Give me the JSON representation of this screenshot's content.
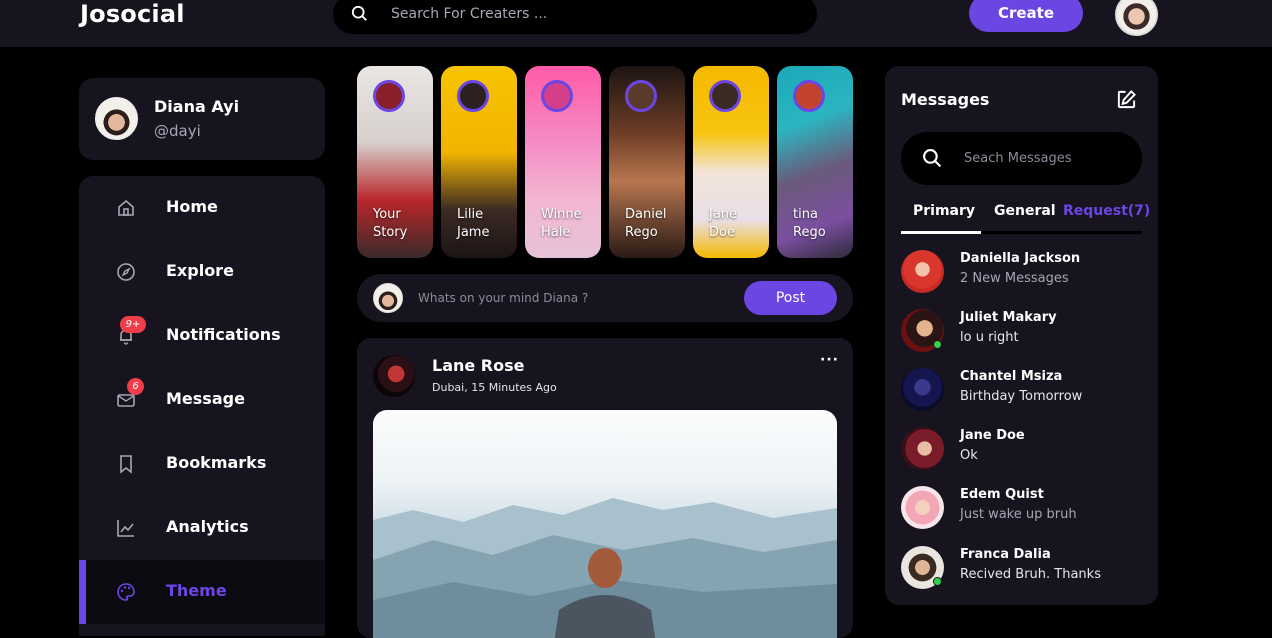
{
  "header": {
    "logo": "Josocial",
    "search_placeholder": "Search For Creaters ...",
    "create_label": "Create"
  },
  "profile": {
    "name": "Diana Ayi",
    "handle": "@dayi"
  },
  "sidebar": {
    "items": [
      {
        "label": "Home",
        "icon": "home-icon"
      },
      {
        "label": "Explore",
        "icon": "compass-icon"
      },
      {
        "label": "Notifications",
        "icon": "bell-icon",
        "badge": "9+"
      },
      {
        "label": "Message",
        "icon": "envelope-icon",
        "badge": "6"
      },
      {
        "label": "Bookmarks",
        "icon": "bookmark-icon"
      },
      {
        "label": "Analytics",
        "icon": "chart-line-icon"
      },
      {
        "label": "Theme",
        "icon": "palette-icon",
        "active": true
      }
    ]
  },
  "stories": [
    {
      "line1": "Your",
      "line2": "Story"
    },
    {
      "line1": "Lilie",
      "line2": "Jame"
    },
    {
      "line1": "Winne",
      "line2": "Hale"
    },
    {
      "line1": "Daniel",
      "line2": "Rego"
    },
    {
      "line1": "Jane",
      "line2": "Doe"
    },
    {
      "line1": "tina",
      "line2": "Rego"
    }
  ],
  "composer": {
    "placeholder": "Whats on your mind Diana ?",
    "post_label": "Post"
  },
  "post": {
    "author": "Lane Rose",
    "location_time": "Dubai, 15 Minutes Ago",
    "more": "···"
  },
  "messages": {
    "title": "Messages",
    "search_placeholder": "Seach Messages",
    "tabs": {
      "primary": "Primary",
      "general": "General",
      "request": "Request(7)"
    },
    "items": [
      {
        "name": "Daniella Jackson",
        "text": "2 New Messages",
        "muted": true,
        "online": false
      },
      {
        "name": "Juliet Makary",
        "text": "lo u right",
        "muted": false,
        "online": true
      },
      {
        "name": "Chantel Msiza",
        "text": "Birthday Tomorrow",
        "muted": false,
        "online": false
      },
      {
        "name": "Jane Doe",
        "text": "Ok",
        "muted": false,
        "online": false
      },
      {
        "name": "Edem Quist",
        "text": "Just wake up bruh",
        "muted": true,
        "online": false
      },
      {
        "name": "Franca Dalia",
        "text": "Recived Bruh. Thanks",
        "muted": false,
        "online": true
      }
    ]
  },
  "colors": {
    "accent": "#6b46e3",
    "panel": "#17141f",
    "badge": "#ef3e4a",
    "online": "#35d04a"
  }
}
